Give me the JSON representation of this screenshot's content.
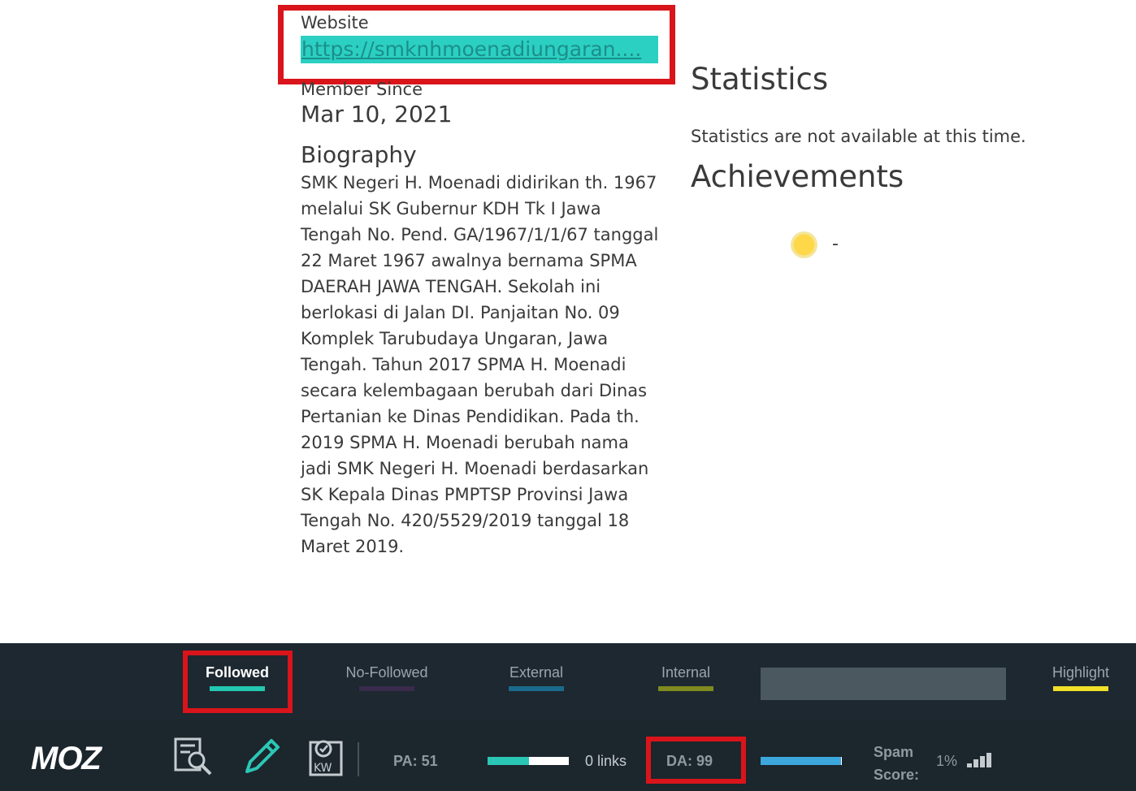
{
  "profile": {
    "website_label": "Website",
    "website_url": "https://smknhmoenadiungaran....",
    "member_since_label": "Member Since",
    "member_since_date": "Mar 10, 2021",
    "biography_label": "Biography",
    "biography_text": "SMK Negeri H. Moenadi didirikan th. 1967 melalui SK Gubernur KDH Tk I Jawa Tengah No. Pend. GA/1967/1/1/67 tanggal 22 Maret 1967 awalnya bernama SPMA DAERAH JAWA TENGAH. Sekolah ini berlokasi di Jalan DI. Panjaitan No. 09 Komplek Tarubudaya Ungaran, Jawa Tengah. Tahun 2017 SPMA H. Moenadi secara kelembagaan berubah dari Dinas Pertanian ke Dinas Pendidikan. Pada th. 2019 SPMA H. Moenadi berubah nama jadi SMK Negeri H. Moenadi berdasarkan SK Kepala Dinas PMPTSP Provinsi Jawa Tengah No. 420/5529/2019 tanggal 18 Maret 2019."
  },
  "statistics": {
    "title": "Statistics",
    "message": "Statistics are not available at this time."
  },
  "achievements": {
    "title": "Achievements",
    "badge_icon": "achievement-badge-icon",
    "value": "-"
  },
  "moz_toolbar": {
    "tabs": [
      {
        "label": "Followed",
        "color": "#24c7b2",
        "active": true
      },
      {
        "label": "No-Followed",
        "color": "#3a2a4c"
      },
      {
        "label": "External",
        "color": "#1a6a8c"
      },
      {
        "label": "Internal",
        "color": "#7f8a1f"
      },
      {
        "label": "Highlight",
        "color": "#f2e02a"
      }
    ],
    "logo": "MOZ",
    "tools": [
      "page-analysis-icon",
      "edit-pencil-icon",
      "keyword-icon"
    ],
    "pa_label": "PA: 51",
    "pa_value": 51,
    "links_label": "0 links",
    "da_label": "DA: 99",
    "da_value": 99,
    "spam_label": "Spam Score:",
    "spam_value": "1%",
    "accent_colors": {
      "highlight_box": "#d9141b",
      "link_highlight": "#2bd0c3"
    }
  }
}
